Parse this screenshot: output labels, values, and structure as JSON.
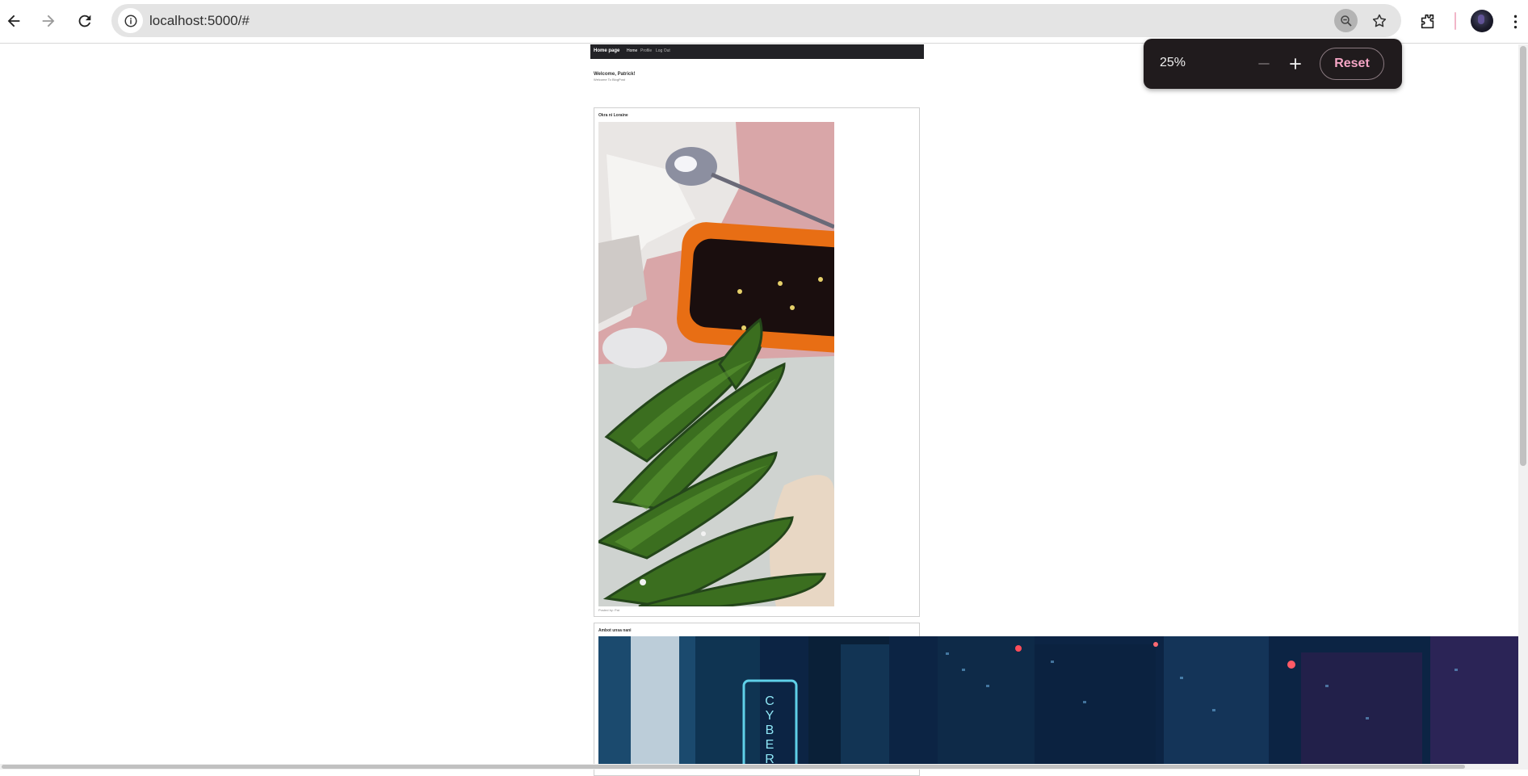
{
  "browser": {
    "url": "localhost:5000/#",
    "nav": {
      "back": "back-arrow",
      "forward": "forward-arrow",
      "reload": "reload"
    },
    "zoom_popup": {
      "level": "25%",
      "minus_label": "−",
      "plus_label": "+",
      "reset_label": "Reset"
    }
  },
  "site": {
    "brand": "Home page",
    "links": [
      "Home",
      "Profile",
      "Log Out"
    ],
    "active_link": "Home",
    "welcome_title": "Welcome, Patrick!",
    "welcome_sub": "Welcome To BlogPost"
  },
  "posts": [
    {
      "title": "Okra ni Loraine",
      "posted_by": "Posted by: Pat"
    },
    {
      "title": "Ambot unsa nani"
    }
  ],
  "colors": {
    "site_nav_bg": "#222226",
    "zoom_popup_bg": "#201b1d",
    "reset_text": "#f5a5c5"
  }
}
